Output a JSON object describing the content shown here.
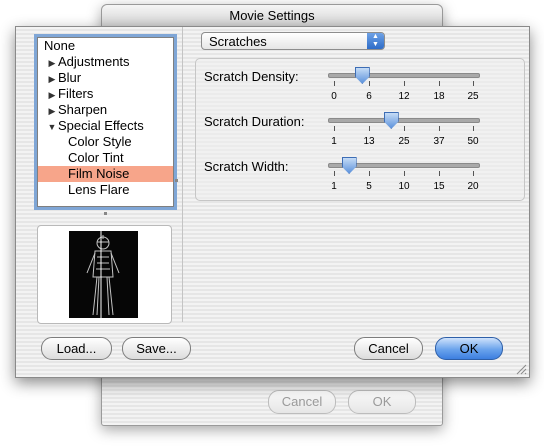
{
  "window": {
    "title": "Movie Settings"
  },
  "back_buttons": {
    "cancel": "Cancel",
    "ok": "OK"
  },
  "filter_list": {
    "items": [
      {
        "label": "None",
        "level": 0,
        "disclosure": ""
      },
      {
        "label": "Adjustments",
        "level": 1,
        "disclosure": "right"
      },
      {
        "label": "Blur",
        "level": 1,
        "disclosure": "right"
      },
      {
        "label": "Filters",
        "level": 1,
        "disclosure": "right"
      },
      {
        "label": "Sharpen",
        "level": 1,
        "disclosure": "right"
      },
      {
        "label": "Special Effects",
        "level": 1,
        "disclosure": "down"
      },
      {
        "label": "Color Style",
        "level": 2,
        "disclosure": ""
      },
      {
        "label": "Color Tint",
        "level": 2,
        "disclosure": ""
      },
      {
        "label": "Film Noise",
        "level": 2,
        "disclosure": "",
        "selected": true
      },
      {
        "label": "Lens Flare",
        "level": 2,
        "disclosure": ""
      }
    ]
  },
  "effect_popup": {
    "value": "Scratches"
  },
  "sliders": [
    {
      "label": "Scratch Density:",
      "value": 5,
      "ticks": [
        "0",
        "6",
        "12",
        "18",
        "25"
      ]
    },
    {
      "label": "Scratch Duration:",
      "value": 21,
      "ticks": [
        "1",
        "13",
        "25",
        "37",
        "50"
      ]
    },
    {
      "label": "Scratch Width:",
      "value": 3,
      "ticks": [
        "1",
        "5",
        "10",
        "15",
        "20"
      ]
    }
  ],
  "buttons": {
    "load": "Load...",
    "save": "Save...",
    "cancel": "Cancel",
    "ok": "OK"
  },
  "colors": {
    "selection": "#f7a58a",
    "focus_ring": "#7fa6d6",
    "default_button": "#3d7fe0"
  }
}
